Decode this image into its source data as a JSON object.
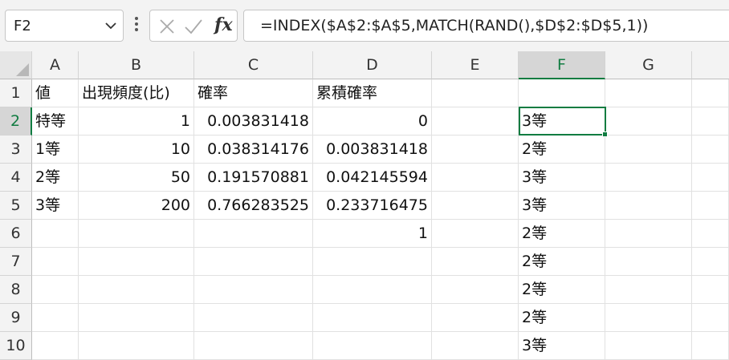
{
  "name_box": {
    "value": "F2"
  },
  "formula_bar": {
    "fx_label": "fx",
    "formula": "=INDEX($A$2:$A$5,MATCH(RAND(),$D$2:$D$5,1))"
  },
  "columns": [
    "A",
    "B",
    "C",
    "D",
    "E",
    "F",
    "G"
  ],
  "rows": [
    "1",
    "2",
    "3",
    "4",
    "5",
    "6",
    "7",
    "8",
    "9",
    "10"
  ],
  "selected": {
    "column": "F",
    "row": "2"
  },
  "cells": {
    "r1": {
      "A": "値",
      "B": "出現頻度(比)",
      "C": "確率",
      "D": "累積確率",
      "F": ""
    },
    "r2": {
      "A": "特等",
      "B": "1",
      "C": "0.003831418",
      "D": "0",
      "F": "3等"
    },
    "r3": {
      "A": "1等",
      "B": "10",
      "C": "0.038314176",
      "D": "0.003831418",
      "F": "2等"
    },
    "r4": {
      "A": "2等",
      "B": "50",
      "C": "0.191570881",
      "D": "0.042145594",
      "F": "3等"
    },
    "r5": {
      "A": "3等",
      "B": "200",
      "C": "0.766283525",
      "D": "0.233716475",
      "F": "3等"
    },
    "r6": {
      "A": "",
      "B": "",
      "C": "",
      "D": "1",
      "F": "2等"
    },
    "r7": {
      "F": "2等"
    },
    "r8": {
      "F": "2等"
    },
    "r9": {
      "F": "2等"
    },
    "r10": {
      "F": "3等"
    }
  }
}
